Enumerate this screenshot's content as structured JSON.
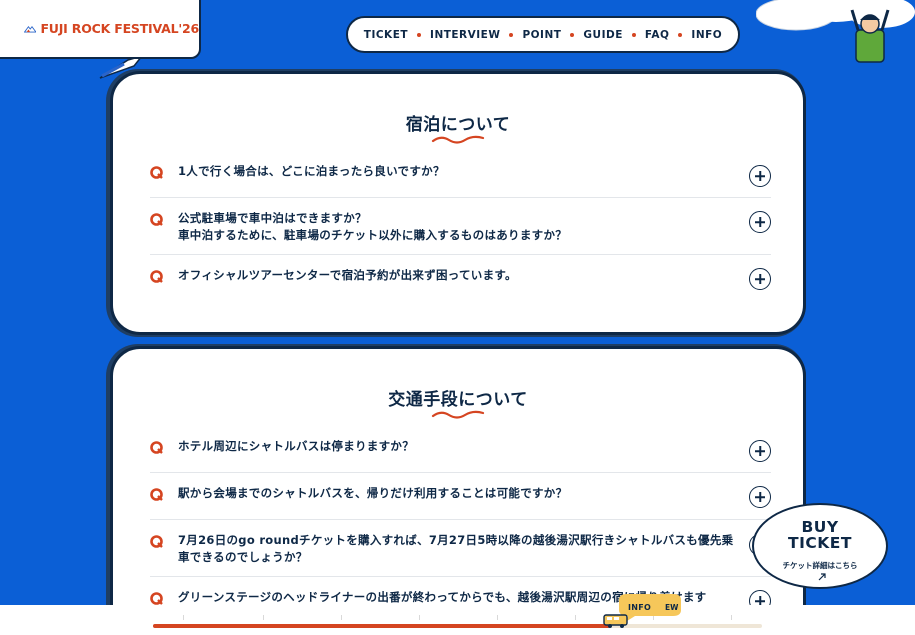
{
  "header": {
    "logo_text": "FUJI ROCK FESTIVAL'26"
  },
  "nav": {
    "items": [
      "TICKET",
      "INTERVIEW",
      "POINT",
      "GUIDE",
      "FAQ",
      "INFO"
    ]
  },
  "sections": [
    {
      "title": "宿泊について",
      "questions": [
        {
          "marker": "Q",
          "text": "1人で行く場合は、どこに泊まったら良いですか？"
        },
        {
          "marker": "Q",
          "text": "公式駐車場で車中泊はできますか？\n車中泊するために、駐車場のチケット以外に購入するものはありますか？"
        },
        {
          "marker": "Q",
          "text": "オフィシャルツアーセンターで宿泊予約が出来ず困っています。"
        }
      ]
    },
    {
      "title": "交通手段について",
      "questions": [
        {
          "marker": "Q",
          "text": "ホテル周辺にシャトルバスは停まりますか？"
        },
        {
          "marker": "Q",
          "text": "駅から会場までのシャトルバスを、帰りだけ利用することは可能ですか？"
        },
        {
          "marker": "Q",
          "text": "7月26日のgo roundチケットを購入すれば、7月27日5時以降の越後湯沢駅行きシャトルバスも優先乗車できるのでしょうか？"
        },
        {
          "marker": "Q",
          "text": "グリーンステージのヘッドライナーの出番が終わってからでも、越後湯沢駅周辺の宿に帰り着けます"
        }
      ]
    }
  ],
  "buy_ticket": {
    "title_line1": "BUY",
    "title_line2": "TICKET",
    "subtitle": "チケット詳細はこちら"
  },
  "progress": {
    "current_label": "INFO",
    "next_label": "EW",
    "fraction": 0.75
  },
  "colors": {
    "background": "#0b5fd6",
    "navy": "#0e2846",
    "accent": "#d54521"
  }
}
